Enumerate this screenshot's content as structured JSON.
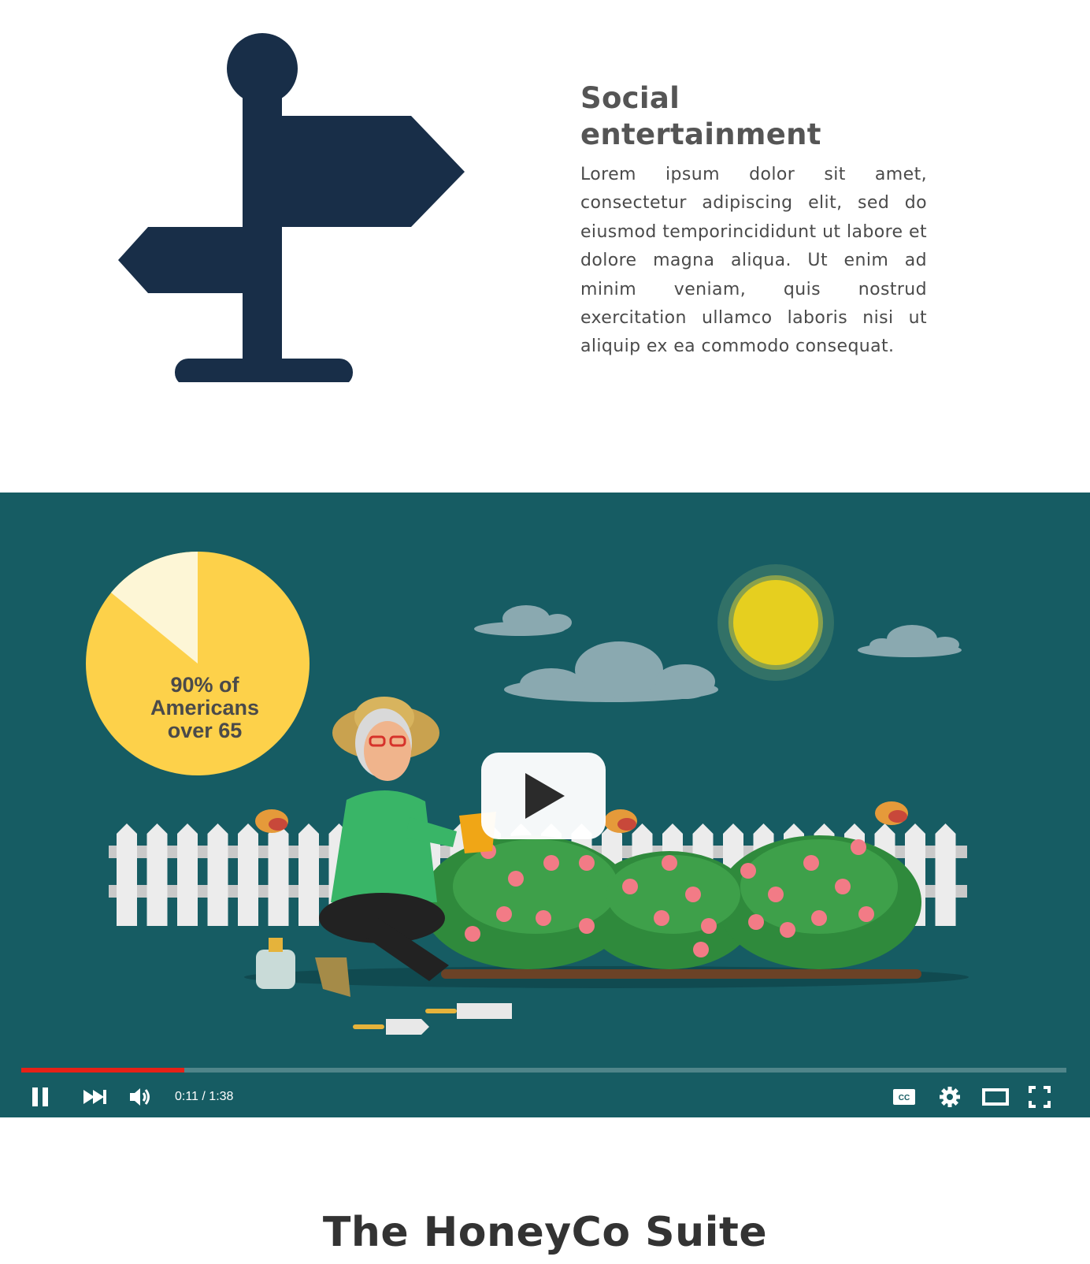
{
  "feature": {
    "title": "Social entertainment",
    "body": "Lorem ipsum dolor sit amet, consectetur adipiscing elit, sed do eiusmod temporincididunt ut labore et dolore magna aliqua. Ut enim ad minim veniam, quis nostrud exercitation ullamco laboris nisi ut aliquip ex ea commodo consequat.",
    "icon": "signpost-icon",
    "icon_color": "#182e48"
  },
  "video": {
    "pie_label_line1": "90% of",
    "pie_label_line2": "Americans",
    "pie_label_line3": "over 65",
    "pie_percent": 90,
    "time_display": "0:11 / 1:38",
    "progress_fraction": 0.156,
    "background_color": "#165c63",
    "progress_color": "#e62117",
    "controls": [
      "pause-icon",
      "next-icon",
      "volume-icon",
      "cc-icon",
      "settings-icon",
      "theater-icon",
      "fullscreen-icon"
    ]
  },
  "suite": {
    "title": "The HoneyCo Suite"
  }
}
